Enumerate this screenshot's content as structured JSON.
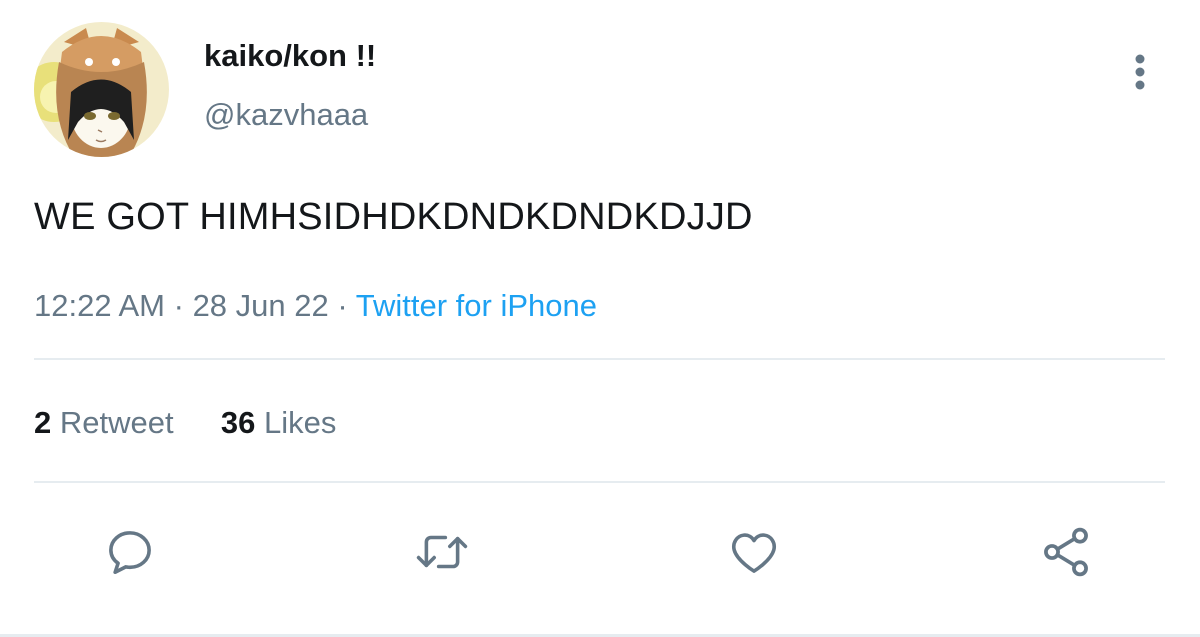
{
  "user": {
    "display_name": "kaiko/kon !!",
    "handle": "@kazvhaaa",
    "avatar_icon": "profile-avatar"
  },
  "tweet": {
    "text": "WE GOT HIMHSIDHDKDNDKDNDKDJJD",
    "time": "12:22 AM",
    "date": "28 Jun 22",
    "separator": "·",
    "source": "Twitter for iPhone"
  },
  "stats": {
    "retweets_count": "2",
    "retweets_label": "Retweet",
    "likes_count": "36",
    "likes_label": "Likes"
  },
  "actions": {
    "reply_icon": "reply-icon",
    "retweet_icon": "retweet-icon",
    "like_icon": "heart-icon",
    "share_icon": "share-icon"
  },
  "colors": {
    "text_primary": "#14171a",
    "text_secondary": "#657786",
    "link": "#1da1f2",
    "divider": "#e6ecf0"
  }
}
